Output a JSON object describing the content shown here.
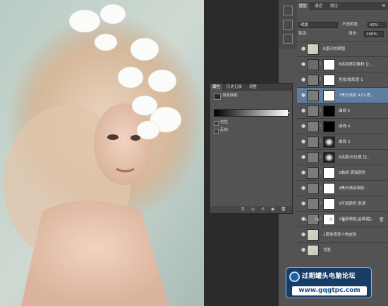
{
  "panels": {
    "tabs": [
      "图层",
      "通道",
      "路径"
    ],
    "blend_mode": "明度",
    "opacity_label": "不透明度:",
    "opacity_value": "42%",
    "lock_label": "锁定:",
    "fill_label": "填充:",
    "fill_value": "100%"
  },
  "layers": [
    {
      "name": "8盖印效果图",
      "thumb": "photo",
      "mask": false,
      "sel": false
    },
    {
      "name": "8添加莲花素材 让...",
      "thumb": "folder",
      "mask": true,
      "sel": false
    },
    {
      "name": "色相/饱和度 1",
      "thumb": "adj",
      "mask": true,
      "sel": false
    },
    {
      "name": "7黑白渐变 42%透...",
      "thumb": "adj",
      "mask": true,
      "sel": true
    },
    {
      "name": "曲线 5",
      "thumb": "adj",
      "mask": "black",
      "sel": false
    },
    {
      "name": "曲线 4",
      "thumb": "adj",
      "mask": "black",
      "sel": false
    },
    {
      "name": "曲线 3",
      "thumb": "adj",
      "mask": "dark",
      "sel": false
    },
    {
      "name": "6亮度/对比度  拉...",
      "thumb": "adj",
      "mask": "dark",
      "sel": false
    },
    {
      "name": "5曲线  调浅颜色",
      "thumb": "adj",
      "mask": true,
      "sel": false
    },
    {
      "name": "4黑白渐变映射 ...",
      "thumb": "adj",
      "mask": true,
      "sel": false
    },
    {
      "name": "3可选颜色  肤调",
      "thumb": "adj",
      "mask": true,
      "sel": false
    },
    {
      "name": "2渐变映射 金属调...",
      "thumb": "adj",
      "mask": true,
      "sel": false
    },
    {
      "name": "1简单修饰人物皮肤",
      "thumb": "photo",
      "mask": false,
      "sel": false
    },
    {
      "name": "背景",
      "thumb": "photo",
      "mask": false,
      "sel": false
    }
  ],
  "properties": {
    "tabs": [
      "属性",
      "历史记录",
      "调整"
    ],
    "type_label": "渐变映射",
    "dither_label": "仿色",
    "reverse_label": "反向"
  },
  "watermark": {
    "title": "过期罐头电脑论坛",
    "url": "www.gqgtpc.com"
  },
  "colors": {
    "selected_row": "#5d7ea0",
    "panel_bg": "#535353"
  }
}
